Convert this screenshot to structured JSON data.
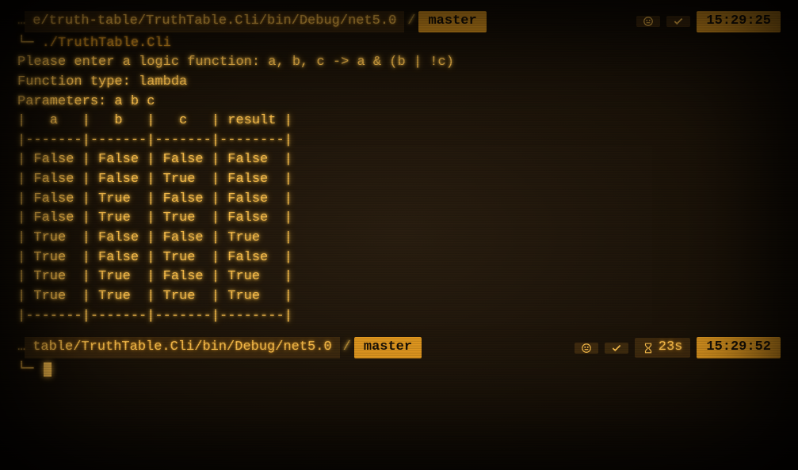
{
  "top_prompt": {
    "lead_dots": "…",
    "path": "e/truth-table/TruthTable.Cli/bin/Debug/net5.0",
    "separator": "/",
    "branch": "master",
    "time": "15:29:25"
  },
  "command": "./TruthTable.Cli",
  "indent_arrow": "└─",
  "intro": {
    "prompt_line": "Please enter a logic function: a, b, c -> a & (b | !c)",
    "type_line": "Function type: lambda",
    "params_line": "Parameters: a b c"
  },
  "table": {
    "columns": [
      "a",
      "b",
      "c",
      "result"
    ],
    "rows": [
      [
        "False",
        "False",
        "False",
        "False"
      ],
      [
        "False",
        "False",
        "True",
        "False"
      ],
      [
        "False",
        "True",
        "False",
        "False"
      ],
      [
        "False",
        "True",
        "True",
        "False"
      ],
      [
        "True",
        "False",
        "False",
        "True"
      ],
      [
        "True",
        "False",
        "True",
        "False"
      ],
      [
        "True",
        "True",
        "False",
        "True"
      ],
      [
        "True",
        "True",
        "True",
        "True"
      ]
    ],
    "border_seg": "-------",
    "border_result": "--------"
  },
  "bottom_prompt": {
    "lead_dots": "…",
    "path": "table/TruthTable.Cli/bin/Debug/net5.0",
    "separator": "/",
    "branch": "master",
    "duration": "23s",
    "time": "15:29:52"
  }
}
